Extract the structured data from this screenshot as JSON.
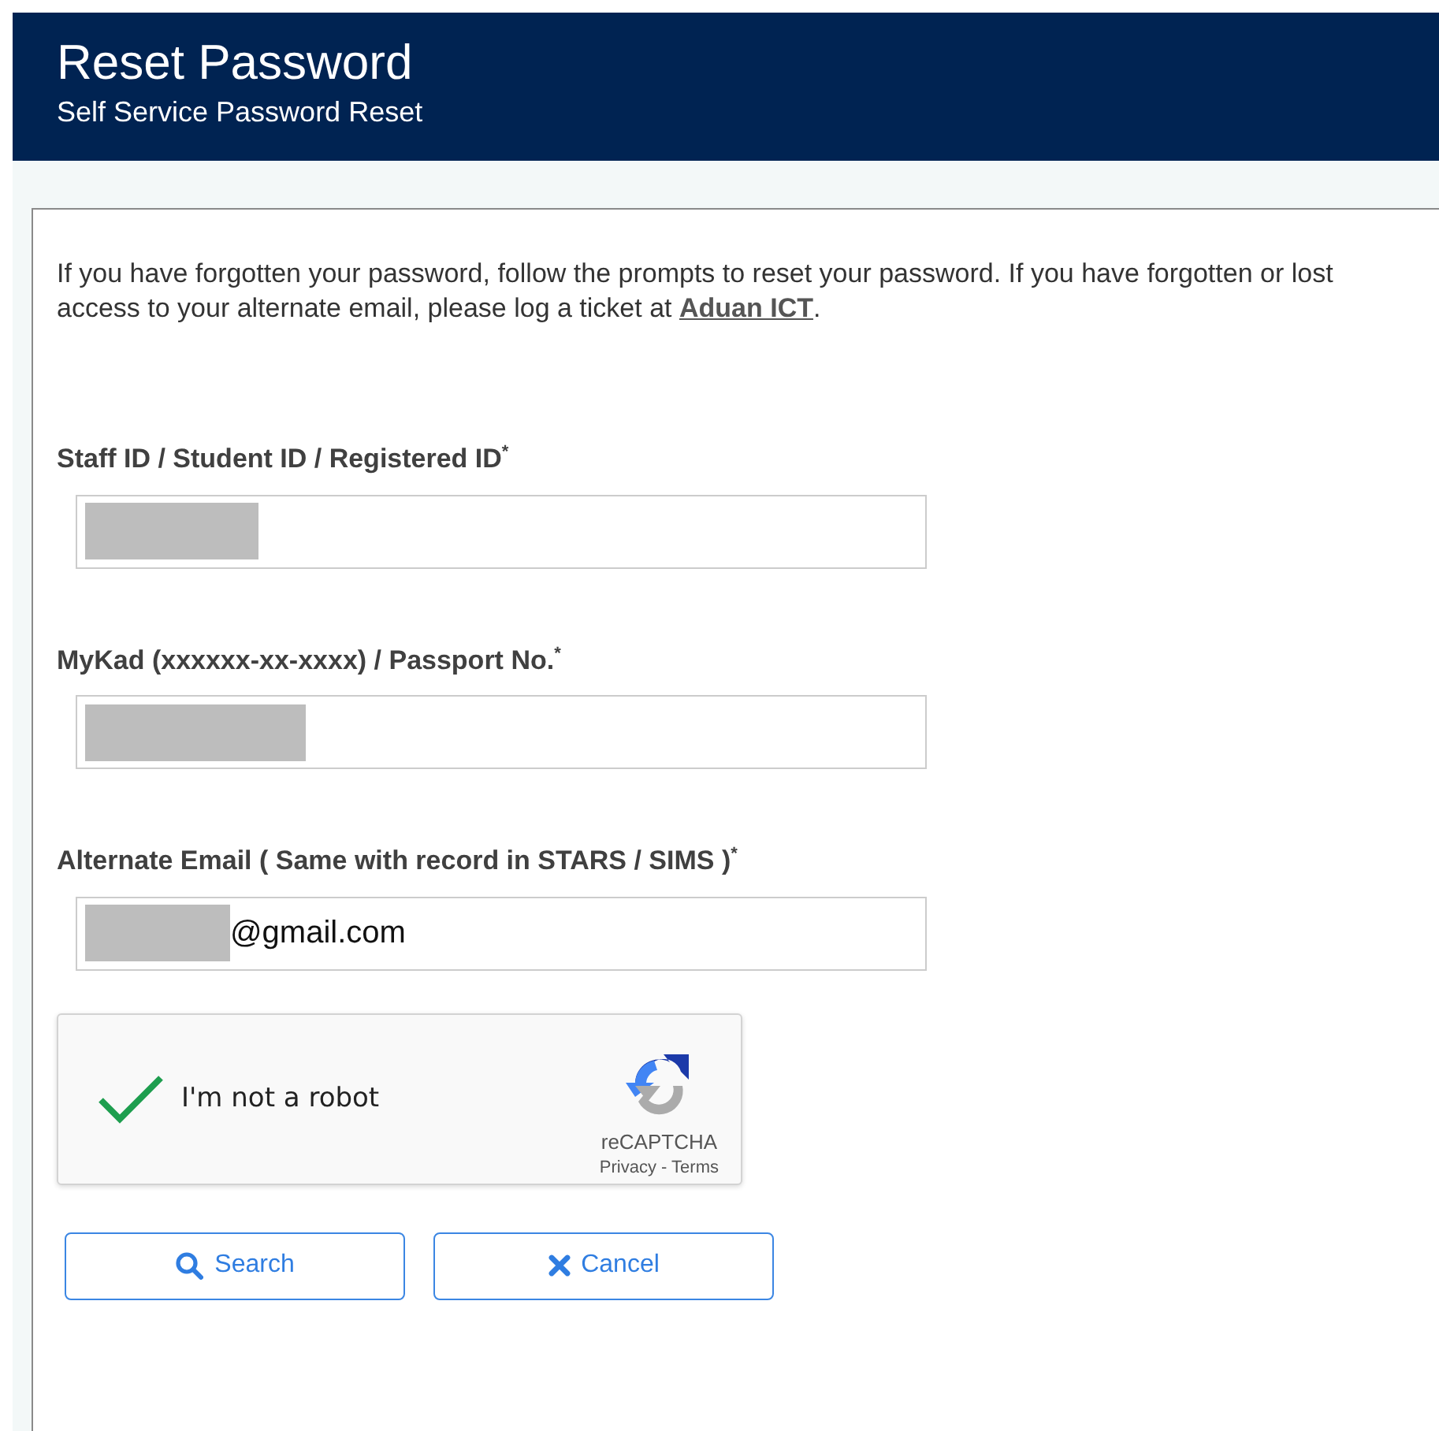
{
  "header": {
    "title": "Reset Password",
    "subtitle": "Self Service Password Reset"
  },
  "intro": {
    "text": "If you have forgotten your password, follow the prompts to reset your password. If you have forgotten or lost access to your alternate email, please log a ticket at ",
    "link": "Aduan ICT",
    "end": "."
  },
  "fields": [
    {
      "label": "Staff ID / Student ID / Registered ID",
      "required_mark": "*",
      "redacted": true
    },
    {
      "label": "MyKad (xxxxxx-xx-xxxx) / Passport No.",
      "required_mark": "*",
      "redacted": true
    },
    {
      "label": "Alternate Email ( Same with record in STARS / SIMS )",
      "required_mark": "*",
      "redacted": true,
      "value": "@gmail.com"
    }
  ],
  "captcha": {
    "label": "I'm not a robot",
    "checked": true,
    "brand": "reCAPTCHA",
    "privacy": "Privacy",
    "separator": " - ",
    "terms": "Terms"
  },
  "buttons": [
    {
      "label": "Search",
      "kind": "search"
    },
    {
      "label": "Cancel",
      "kind": "cancel"
    }
  ]
}
